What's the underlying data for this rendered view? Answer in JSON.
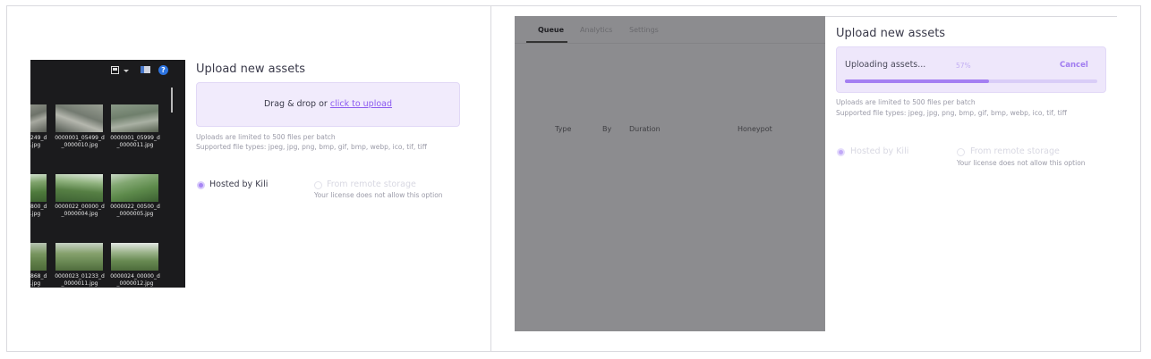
{
  "left_panel": {
    "title": "Upload new assets",
    "dropzone": {
      "text": "Drag & drop or ",
      "link": "click to upload"
    },
    "limit_hint": "Uploads are limited to 500 files per batch",
    "types_hint": "Supported file types: jpeg, jpg, png, bmp, gif, bmp, webp, ico, tif, tiff",
    "option_hosted": "Hosted by Kili",
    "option_remote": "From remote storage",
    "remote_note": "Your license does not allow this option",
    "explorer": {
      "files": [
        "249_d\n.jpg",
        "0000001_05499_d\n_0000010.jpg",
        "0000001_05999_d\n_0000011.jpg",
        "800_d\n.jpg",
        "0000022_00000_d\n_0000004.jpg",
        "0000022_00500_d\n_0000005.jpg",
        "868_d\n.jpg",
        "0000023_01233_d\n_0000011.jpg",
        "0000024_00000_d\n_0000012.jpg"
      ]
    }
  },
  "right_panel": {
    "tabs": [
      "Queue",
      "Analytics",
      "Settings"
    ],
    "columns": [
      "Type",
      "By",
      "Duration",
      "Honeypot"
    ],
    "title": "Upload new assets",
    "uploading_label": "Uploading assets...",
    "progress_text": "57%",
    "progress": 0.57,
    "cancel_label": "Cancel",
    "limit_hint": "Uploads are limited to 500 files per batch",
    "types_hint": "Supported file types: jpeg, jpg, png, bmp, gif, bmp, webp, ico, tif, tiff",
    "option_hosted": "Hosted by Kili",
    "option_remote": "From remote storage",
    "remote_note": "Your license does not allow this option"
  },
  "colors": {
    "accent": "#a47ff2",
    "link": "#8c5bf0",
    "dropzone_bg": "#f1ebfc"
  }
}
